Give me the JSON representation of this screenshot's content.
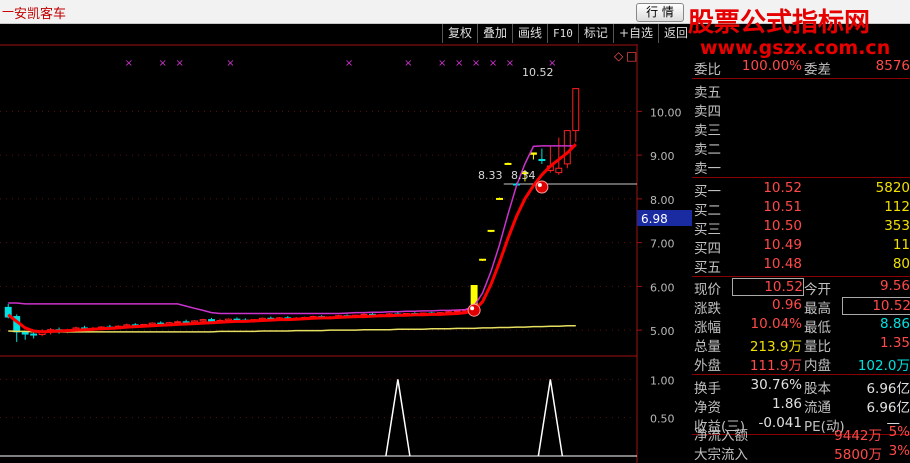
{
  "window": {
    "mark": "一",
    "title": "安凯客车",
    "quote_button": "行 情"
  },
  "watermark": {
    "line1": "股票公式指标网",
    "line2": "www.gszx.com.cn"
  },
  "toolbar": [
    "复权",
    "叠加",
    "画线",
    "F10",
    "标记",
    "+自选",
    "返回"
  ],
  "chart_icons": {
    "diamond": "◇",
    "square": "□"
  },
  "price_axis": [
    "10.00",
    "9.00",
    "8.00",
    "7.00",
    "6.00",
    "5.00"
  ],
  "current_price_tag": "6.98",
  "price_annotations": [
    "10.52",
    "8.33",
    "8.34"
  ],
  "indicator_axis": [
    "1.00",
    "0.50"
  ],
  "colors": {
    "up": "#ff2020",
    "down": "#00e0e0",
    "ma_main": "#ff0000",
    "ma_upper": "#cc33cc",
    "ma_low": "#e8e060",
    "signal": "#ffffff",
    "marker": "#cc33cc"
  },
  "chart_data": {
    "type": "candlestick",
    "price_ylim": [
      4.5,
      10.9
    ],
    "price_ticks": [
      5,
      6,
      7,
      8,
      9,
      10
    ],
    "candles": [
      {
        "o": 5.52,
        "h": 5.6,
        "l": 5.27,
        "c": 5.3
      },
      {
        "o": 5.31,
        "h": 5.36,
        "l": 4.73,
        "c": 4.96
      },
      {
        "o": 4.96,
        "h": 4.98,
        "l": 4.78,
        "c": 4.91
      },
      {
        "o": 4.91,
        "h": 4.97,
        "l": 4.81,
        "c": 4.9
      },
      {
        "o": 4.9,
        "h": 5.02,
        "l": 4.86,
        "c": 4.98
      },
      {
        "o": 4.98,
        "h": 5.05,
        "l": 4.9,
        "c": 5.01
      },
      {
        "o": 5.01,
        "h": 5.06,
        "l": 4.92,
        "c": 4.96
      },
      {
        "o": 4.96,
        "h": 5.03,
        "l": 4.93,
        "c": 5.0
      },
      {
        "o": 5.0,
        "h": 5.08,
        "l": 4.95,
        "c": 5.05
      },
      {
        "o": 5.05,
        "h": 5.1,
        "l": 4.99,
        "c": 5.02
      },
      {
        "o": 5.02,
        "h": 5.07,
        "l": 4.98,
        "c": 5.04
      },
      {
        "o": 5.04,
        "h": 5.09,
        "l": 5.0,
        "c": 5.07
      },
      {
        "o": 5.07,
        "h": 5.12,
        "l": 5.02,
        "c": 5.06
      },
      {
        "o": 5.06,
        "h": 5.11,
        "l": 5.03,
        "c": 5.09
      },
      {
        "o": 5.09,
        "h": 5.15,
        "l": 5.06,
        "c": 5.12
      },
      {
        "o": 5.12,
        "h": 5.16,
        "l": 5.08,
        "c": 5.1
      },
      {
        "o": 5.1,
        "h": 5.14,
        "l": 5.07,
        "c": 5.13
      },
      {
        "o": 5.13,
        "h": 5.18,
        "l": 5.1,
        "c": 5.16
      },
      {
        "o": 5.16,
        "h": 5.2,
        "l": 5.11,
        "c": 5.14
      },
      {
        "o": 5.14,
        "h": 5.19,
        "l": 5.1,
        "c": 5.17
      },
      {
        "o": 5.17,
        "h": 5.22,
        "l": 5.13,
        "c": 5.19
      },
      {
        "o": 5.19,
        "h": 5.24,
        "l": 5.15,
        "c": 5.18
      },
      {
        "o": 5.18,
        "h": 5.23,
        "l": 5.14,
        "c": 5.21
      },
      {
        "o": 5.21,
        "h": 5.26,
        "l": 5.17,
        "c": 5.24
      },
      {
        "o": 5.24,
        "h": 5.28,
        "l": 5.18,
        "c": 5.2
      },
      {
        "o": 5.2,
        "h": 5.26,
        "l": 5.16,
        "c": 5.22
      },
      {
        "o": 5.22,
        "h": 5.27,
        "l": 5.19,
        "c": 5.25
      },
      {
        "o": 5.25,
        "h": 5.29,
        "l": 5.2,
        "c": 5.23
      },
      {
        "o": 5.23,
        "h": 5.27,
        "l": 5.19,
        "c": 5.21
      },
      {
        "o": 5.21,
        "h": 5.25,
        "l": 5.17,
        "c": 5.24
      },
      {
        "o": 5.24,
        "h": 5.29,
        "l": 5.21,
        "c": 5.27
      },
      {
        "o": 5.27,
        "h": 5.31,
        "l": 5.22,
        "c": 5.25
      },
      {
        "o": 5.25,
        "h": 5.3,
        "l": 5.21,
        "c": 5.28
      },
      {
        "o": 5.28,
        "h": 5.32,
        "l": 5.24,
        "c": 5.26
      },
      {
        "o": 5.26,
        "h": 5.3,
        "l": 5.22,
        "c": 5.27
      },
      {
        "o": 5.27,
        "h": 5.31,
        "l": 5.23,
        "c": 5.29
      },
      {
        "o": 5.29,
        "h": 5.33,
        "l": 5.25,
        "c": 5.31
      },
      {
        "o": 5.31,
        "h": 5.34,
        "l": 5.27,
        "c": 5.28
      },
      {
        "o": 5.28,
        "h": 5.32,
        "l": 5.25,
        "c": 5.3
      },
      {
        "o": 5.3,
        "h": 5.35,
        "l": 5.27,
        "c": 5.33
      },
      {
        "o": 5.33,
        "h": 5.36,
        "l": 5.28,
        "c": 5.31
      },
      {
        "o": 5.31,
        "h": 5.35,
        "l": 5.27,
        "c": 5.34
      },
      {
        "o": 5.34,
        "h": 5.38,
        "l": 5.3,
        "c": 5.36
      },
      {
        "o": 5.36,
        "h": 5.4,
        "l": 5.31,
        "c": 5.33
      },
      {
        "o": 5.33,
        "h": 5.37,
        "l": 5.29,
        "c": 5.35
      },
      {
        "o": 5.35,
        "h": 5.39,
        "l": 5.31,
        "c": 5.37
      },
      {
        "o": 5.37,
        "h": 5.41,
        "l": 5.33,
        "c": 5.35
      },
      {
        "o": 5.35,
        "h": 5.39,
        "l": 5.32,
        "c": 5.38
      },
      {
        "o": 5.38,
        "h": 5.41,
        "l": 5.33,
        "c": 5.36
      },
      {
        "o": 5.36,
        "h": 5.4,
        "l": 5.32,
        "c": 5.39
      },
      {
        "o": 5.39,
        "h": 5.42,
        "l": 5.34,
        "c": 5.37
      },
      {
        "o": 5.37,
        "h": 5.41,
        "l": 5.33,
        "c": 5.4
      },
      {
        "o": 5.4,
        "h": 5.44,
        "l": 5.36,
        "c": 5.42
      },
      {
        "o": 5.42,
        "h": 5.46,
        "l": 5.39,
        "c": 5.44
      },
      {
        "o": 5.44,
        "h": 5.49,
        "l": 5.42,
        "c": 5.47
      },
      {
        "o": 5.47,
        "h": 6.02,
        "l": 5.45,
        "c": 6.02
      },
      {
        "o": 6.6,
        "h": 6.62,
        "l": 6.58,
        "c": 6.62
      },
      {
        "o": 7.26,
        "h": 7.28,
        "l": 7.24,
        "c": 7.28
      },
      {
        "o": 8.01,
        "h": 8.03,
        "l": 7.99,
        "c": 8.01
      },
      {
        "o": 8.81,
        "h": 8.83,
        "l": 8.79,
        "c": 8.81
      },
      {
        "o": 8.33,
        "h": 8.37,
        "l": 8.33,
        "c": 8.34
      },
      {
        "o": 8.6,
        "h": 8.66,
        "l": 8.4,
        "c": 8.6
      },
      {
        "o": 9.02,
        "h": 9.05,
        "l": 8.9,
        "c": 9.05
      },
      {
        "o": 8.9,
        "h": 9.15,
        "l": 8.8,
        "c": 8.88
      },
      {
        "o": 8.65,
        "h": 9.2,
        "l": 8.6,
        "c": 8.75
      },
      {
        "o": 8.6,
        "h": 9.4,
        "l": 8.55,
        "c": 8.7
      },
      {
        "o": 8.8,
        "h": 9.5,
        "l": 8.7,
        "c": 9.56
      },
      {
        "o": 9.56,
        "h": 10.52,
        "l": 9.3,
        "c": 10.52
      }
    ],
    "ma_main": [
      5.35,
      5.2,
      5.05,
      4.98,
      4.96,
      4.97,
      4.98,
      4.99,
      5.0,
      5.01,
      5.02,
      5.03,
      5.04,
      5.05,
      5.07,
      5.08,
      5.09,
      5.1,
      5.11,
      5.12,
      5.13,
      5.14,
      5.15,
      5.16,
      5.17,
      5.18,
      5.19,
      5.2,
      5.2,
      5.21,
      5.22,
      5.23,
      5.24,
      5.24,
      5.25,
      5.26,
      5.27,
      5.28,
      5.28,
      5.29,
      5.3,
      5.31,
      5.31,
      5.32,
      5.33,
      5.33,
      5.34,
      5.34,
      5.35,
      5.35,
      5.36,
      5.36,
      5.37,
      5.38,
      5.4,
      5.45,
      5.65,
      6.05,
      6.55,
      7.1,
      7.6,
      8.0,
      8.3,
      8.55,
      8.75,
      8.9,
      9.05,
      9.25
    ],
    "ma_upper": [
      5.62,
      5.62,
      5.6,
      5.6,
      5.6,
      5.6,
      5.6,
      5.6,
      5.6,
      5.6,
      5.6,
      5.6,
      5.6,
      5.6,
      5.6,
      5.6,
      5.6,
      5.6,
      5.6,
      5.6,
      5.6,
      5.55,
      5.5,
      5.45,
      5.4,
      5.38,
      5.38,
      5.38,
      5.38,
      5.38,
      5.38,
      5.38,
      5.38,
      5.38,
      5.38,
      5.38,
      5.38,
      5.38,
      5.38,
      5.38,
      5.39,
      5.4,
      5.4,
      5.41,
      5.41,
      5.42,
      5.42,
      5.43,
      5.43,
      5.44,
      5.44,
      5.45,
      5.45,
      5.46,
      5.47,
      5.55,
      5.85,
      6.35,
      6.95,
      7.65,
      8.3,
      8.8,
      9.2,
      9.21,
      9.21,
      9.21,
      9.21,
      9.21
    ],
    "ma_low": [
      4.98,
      4.97,
      4.97,
      4.96,
      4.96,
      4.96,
      4.96,
      4.96,
      4.96,
      4.96,
      4.96,
      4.96,
      4.96,
      4.96,
      4.96,
      4.96,
      4.96,
      4.96,
      4.96,
      4.96,
      4.96,
      4.96,
      4.96,
      4.96,
      4.96,
      4.97,
      4.97,
      4.97,
      4.97,
      4.97,
      4.98,
      4.98,
      4.98,
      4.98,
      4.99,
      4.99,
      4.99,
      4.99,
      5.0,
      5.0,
      5.0,
      5.0,
      5.01,
      5.01,
      5.01,
      5.01,
      5.02,
      5.02,
      5.02,
      5.02,
      5.03,
      5.03,
      5.03,
      5.04,
      5.04,
      5.04,
      5.05,
      5.05,
      5.06,
      5.06,
      5.07,
      5.07,
      5.08,
      5.08,
      5.09,
      5.09,
      5.1,
      5.1
    ],
    "support_line": 8.34,
    "markers_top": [
      14,
      18,
      20,
      26,
      40,
      47,
      51,
      53,
      55,
      57,
      59,
      64
    ],
    "signal_candles": [
      46,
      64
    ],
    "indicator_ylim": [
      0,
      1.2
    ],
    "indicator_ticks": [
      0.5,
      1.0
    ],
    "indicator_values": [
      0,
      0,
      0,
      0,
      0,
      0,
      0,
      0,
      0,
      0,
      0,
      0,
      0,
      0,
      0,
      0,
      0,
      0,
      0,
      0,
      0,
      0,
      0,
      0,
      0,
      0,
      0,
      0,
      0,
      0,
      0,
      0,
      0,
      0,
      0,
      0,
      0,
      0,
      0,
      0,
      0,
      0,
      0,
      0,
      0,
      0,
      1,
      0,
      0,
      0,
      0,
      0,
      0,
      0,
      0,
      0,
      0,
      0,
      0,
      0,
      0,
      0,
      0,
      0,
      1,
      0,
      0,
      0
    ]
  },
  "quote": {
    "top_row": {
      "l1": "委比",
      "v1": "100.00%",
      "l2": "委差",
      "v2": "8576"
    },
    "sells": [
      {
        "label": "卖五",
        "price": "",
        "vol": ""
      },
      {
        "label": "卖四",
        "price": "",
        "vol": ""
      },
      {
        "label": "卖三",
        "price": "",
        "vol": ""
      },
      {
        "label": "卖二",
        "price": "",
        "vol": ""
      },
      {
        "label": "卖一",
        "price": "",
        "vol": ""
      }
    ],
    "buys": [
      {
        "label": "买一",
        "price": "10.52",
        "vol": "5820"
      },
      {
        "label": "买二",
        "price": "10.51",
        "vol": "112"
      },
      {
        "label": "买三",
        "price": "10.50",
        "vol": "353"
      },
      {
        "label": "买四",
        "price": "10.49",
        "vol": "11"
      },
      {
        "label": "买五",
        "price": "10.48",
        "vol": "80"
      }
    ],
    "stats": [
      {
        "l1": "现价",
        "v1": "10.52",
        "l2": "今开",
        "v2": "9.56"
      },
      {
        "l1": "涨跌",
        "v1": "0.96",
        "l2": "最高",
        "v2": "10.52"
      },
      {
        "l1": "涨幅",
        "v1": "10.04%",
        "l2": "最低",
        "v2": "8.86"
      },
      {
        "l1": "总量",
        "v1": "213.9万",
        "l2": "量比",
        "v2": "1.35"
      },
      {
        "l1": "外盘",
        "v1": "111.9万",
        "l2": "内盘",
        "v2": "102.0万"
      }
    ],
    "fundamentals": [
      {
        "l1": "换手",
        "v1": "30.76%",
        "l2": "股本",
        "v2": "6.96亿"
      },
      {
        "l1": "净资",
        "v1": "1.86",
        "l2": "流通",
        "v2": "6.96亿"
      },
      {
        "l1": "收益(三)",
        "v1": "-0.041",
        "l2": "PE(动)",
        "v2": "—"
      }
    ],
    "flows": [
      {
        "label": "净流入额",
        "value": "9442万",
        "pct": "5%"
      },
      {
        "label": "大宗流入",
        "value": "5800万",
        "pct": "3%"
      }
    ]
  }
}
